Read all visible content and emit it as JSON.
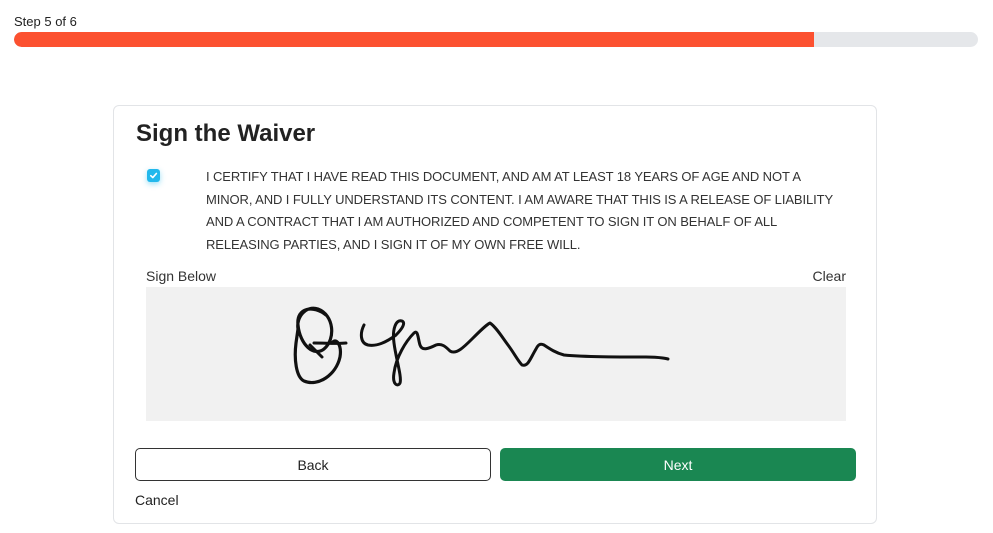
{
  "progress": {
    "step_text": "Step 5 of 6",
    "fraction": 0.83,
    "fill_color": "#fc5130",
    "track_color": "#e5e7ea"
  },
  "waiver": {
    "title": "Sign the Waiver",
    "checkbox_checked": true,
    "checkbox_color": "#22b8ec",
    "certify_text": "I CERTIFY THAT I HAVE READ THIS DOCUMENT, AND AM AT LEAST 18 YEARS OF AGE AND NOT A MINOR, AND I FULLY UNDERSTAND ITS CONTENT. I AM AWARE THAT THIS IS A RELEASE OF LIABILITY AND A CONTRACT THAT I AM AUTHORIZED AND COMPETENT TO SIGN IT ON BEHALF OF ALL RELEASING PARTIES, AND I SIGN IT OF MY OWN FREE WILL.",
    "sign_label": "Sign Below",
    "clear_label": "Clear"
  },
  "actions": {
    "back_label": "Back",
    "next_label": "Next",
    "next_color": "#1a8752",
    "cancel_label": "Cancel"
  }
}
